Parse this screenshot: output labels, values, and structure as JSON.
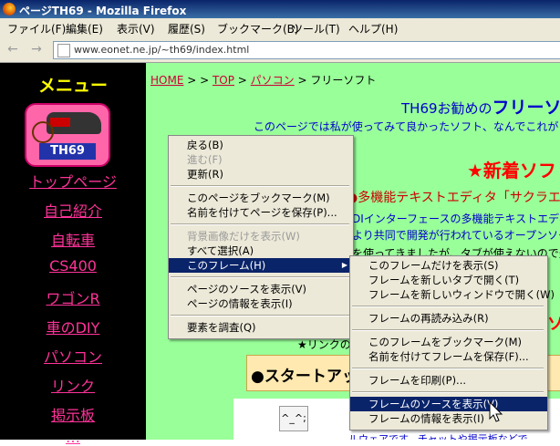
{
  "window": {
    "title": "ページTH69 - Mozilla Firefox"
  },
  "menubar": {
    "items": [
      "ファイル(F)",
      "編集(E)",
      "表示(V)",
      "履歴(S)",
      "ブックマーク(B)",
      "ツール(T)",
      "ヘルプ(H)"
    ]
  },
  "navbar": {
    "back_icon": "←",
    "forward_icon": "→",
    "url": "www.eonet.ne.jp/~th69/index.html"
  },
  "left": {
    "heading": "メニュー",
    "logo_text": "TH69",
    "links": [
      "トップページ",
      "自己紹介",
      "自転車",
      "CS400",
      "ワゴンR",
      "車のDIY",
      "パソコン",
      "リンク",
      "掲示板",
      "…"
    ]
  },
  "right": {
    "breadcrumb": {
      "home": "HOME",
      "sep1": " > > ",
      "top": "TOP",
      "sep2": " > ",
      "pc": "パソコン",
      "sep3": " > ",
      "current": "フリーソフト"
    },
    "title_prefix": "TH69お勧めの",
    "title_strong": "フリーソ",
    "intro": "このページでは私が使ってみて良かったソフト、なんでこれがフリー",
    "new_heading": "★新着ソフ",
    "item_title": "●多機能テキストエディタ「サクラエ",
    "item_line1": "DIインターフェースの多機能テキストエディタ",
    "item_line2": "より共同で開発が行われているオープンソー",
    "item_line3": "を使ってきましたが、タブが使えないので乗",
    "partial_text": "ソ",
    "link_note": "★リンクの",
    "start_heading": "●スタートアッ",
    "face_text": "^_^;",
    "bottom_text": "ルウェアです。チャットや掲示板などで"
  },
  "context_menu": {
    "items": [
      {
        "label": "戻る(B)",
        "disabled": false
      },
      {
        "label": "進む(F)",
        "disabled": true
      },
      {
        "label": "更新(R)",
        "disabled": false
      },
      {
        "label": "このページをブックマーク(M)",
        "disabled": false
      },
      {
        "label": "名前を付けてページを保存(P)...",
        "disabled": false
      },
      {
        "label": "背景画像だけを表示(W)",
        "disabled": true
      },
      {
        "label": "すべて選択(A)",
        "disabled": false
      },
      {
        "label": "このフレーム(H)",
        "disabled": false,
        "selected": true,
        "submenu_arrow": "▶"
      },
      {
        "label": "ページのソースを表示(V)",
        "disabled": false
      },
      {
        "label": "ページの情報を表示(I)",
        "disabled": false
      },
      {
        "label": "要素を調査(Q)",
        "disabled": false
      }
    ]
  },
  "submenu": {
    "items": [
      {
        "label": "このフレームだけを表示(S)"
      },
      {
        "label": "フレームを新しいタブで開く(T)"
      },
      {
        "label": "フレームを新しいウィンドウで開く(W)"
      },
      {
        "label": "フレームの再読み込み(R)"
      },
      {
        "label": "このフレームをブックマーク(M)"
      },
      {
        "label": "名前を付けてフレームを保存(F)..."
      },
      {
        "label": "フレームを印刷(P)..."
      },
      {
        "label": "フレームのソースを表示(V)",
        "selected": true
      },
      {
        "label": "フレームの情報を表示(I)"
      }
    ]
  },
  "colors": {
    "link": "#cc0033",
    "left_link": "#ff3399",
    "accent_red": "#ff0000",
    "title_blue": "#0000cc",
    "frame_bg": "#99ff99"
  }
}
